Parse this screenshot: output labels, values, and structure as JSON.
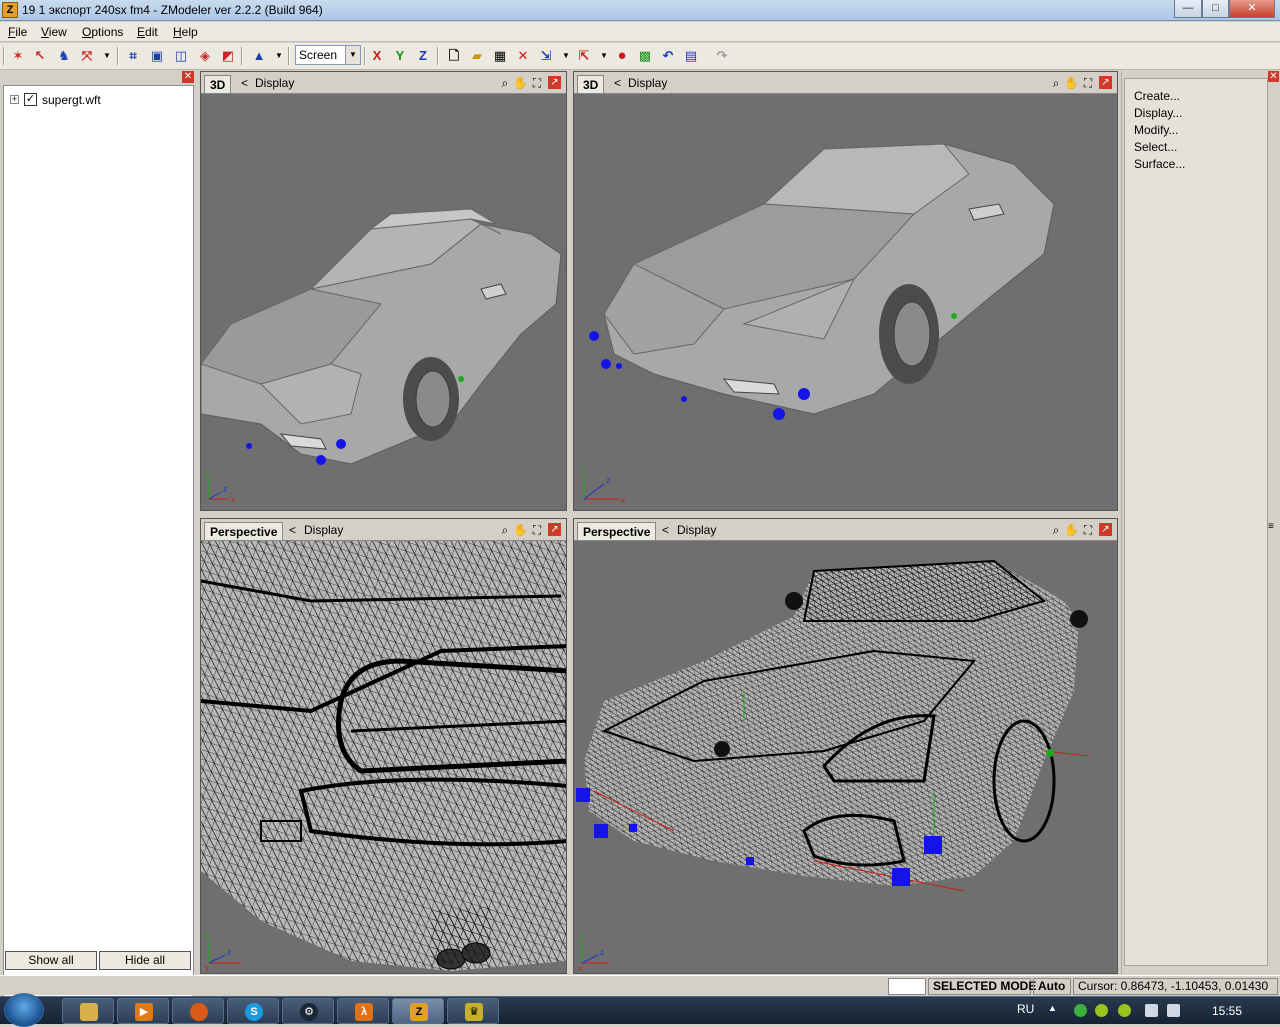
{
  "window": {
    "title": "19  1 экспорт 240sx fm4 - ZModeler ver 2.2.2 (Build 964)",
    "app_icon": "Z",
    "buttons": {
      "minimize": "—",
      "maximize": "□",
      "close": "✕"
    }
  },
  "menu": [
    "File",
    "View",
    "Options",
    "Edit",
    "Help"
  ],
  "toolbar": {
    "screen_select": "Screen",
    "axis_x": "X",
    "axis_y": "Y",
    "axis_z": "Z",
    "icons": [
      "select-vertex-icon",
      "move-icon",
      "run-icon",
      "transform-icon",
      "box-icon",
      "cube-icon",
      "sphere-icon",
      "cylinder-icon",
      "color-triangle-icon",
      "new-file-icon",
      "open-file-icon",
      "save-icon",
      "delete-icon",
      "import-icon",
      "export-icon",
      "record-icon",
      "render-icon",
      "undo-icon",
      "notes-icon",
      "redo-icon"
    ]
  },
  "left_panel": {
    "tree": [
      {
        "label": "supergt.wft",
        "checked": true,
        "expandable": true
      }
    ],
    "show_all": "Show all",
    "hide_all": "Hide all"
  },
  "viewports": [
    {
      "mode": "3D",
      "display": "Display",
      "render": "shaded"
    },
    {
      "mode": "3D",
      "display": "Display",
      "render": "shaded"
    },
    {
      "mode": "Perspective",
      "display": "Display",
      "render": "wireframe"
    },
    {
      "mode": "Perspective",
      "display": "Display",
      "render": "wireframe"
    }
  ],
  "viewport_axes": {
    "x": "x",
    "y": "y",
    "z": "z"
  },
  "right_panel": {
    "commands": [
      "Create...",
      "Display...",
      "Modify...",
      "Select...",
      "Surface..."
    ]
  },
  "status": {
    "mode": "SELECTED MODE",
    "auto": "Auto",
    "cursor": "Cursor: 0.86473, -1.10453, 0.01430"
  },
  "taskbar": {
    "language": "RU",
    "time": "15:55",
    "apps": [
      "explorer",
      "media-player",
      "firefox",
      "skype",
      "steam",
      "half-life",
      "zmodeler",
      "hoi-app"
    ]
  },
  "colors": {
    "viewport_bg": "#6e6e6e",
    "marker_blue": "#1414e6",
    "marker_green": "#1eaa1e",
    "panel_bg": "#d4d0c8"
  }
}
